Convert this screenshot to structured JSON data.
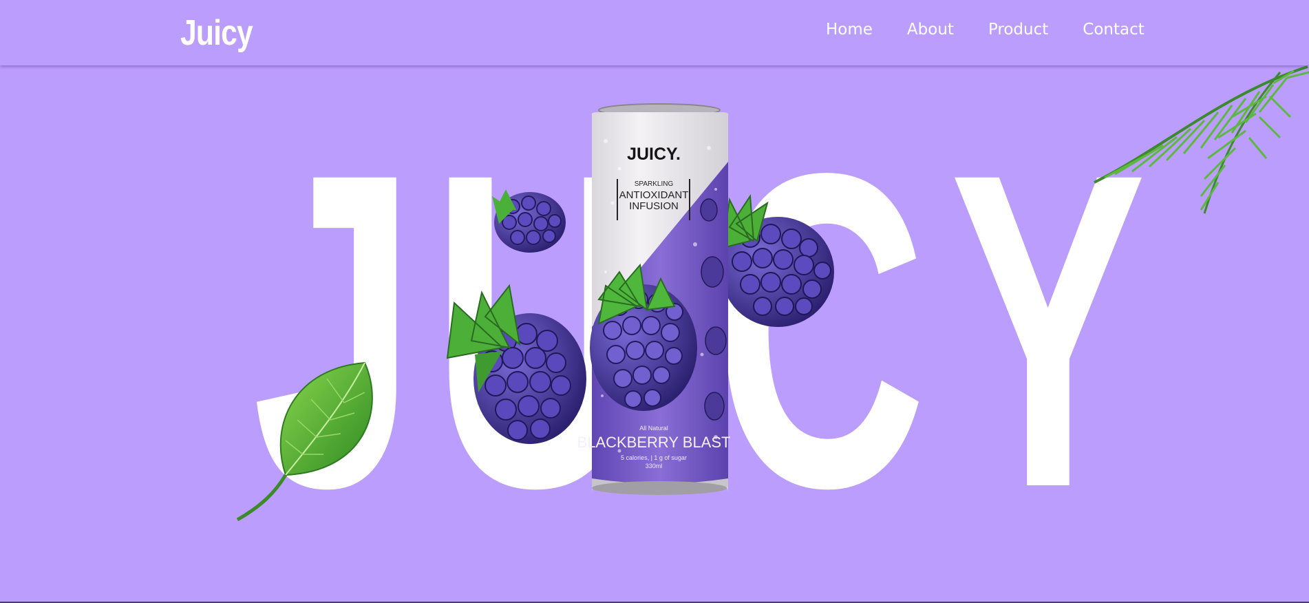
{
  "header": {
    "logo": "Juicy",
    "nav": [
      "Home",
      "About",
      "Product",
      "Contact"
    ]
  },
  "hero": {
    "big_word": [
      "J",
      "U",
      "I",
      "C",
      "Y"
    ],
    "can": {
      "brand": "JUICY.",
      "line1": "SPARKLING",
      "line2": "ANTIOXIDANT",
      "line3": "INFUSION",
      "tag": "All Natural",
      "flavor": "BLACKBERRY BLAST",
      "nutrition": "5 calories, | 1 g of sugar",
      "volume": "330ml"
    }
  },
  "colors": {
    "background": "#bb9dfd",
    "text": "#ffffff",
    "can_top": "#efedf0",
    "can_purple": "#7a5cc9",
    "berry": "#4b3a9a",
    "leaf": "#58b83a"
  },
  "icons": [
    "palm-leaf-icon",
    "green-leaf-icon",
    "blackberry-icon"
  ]
}
